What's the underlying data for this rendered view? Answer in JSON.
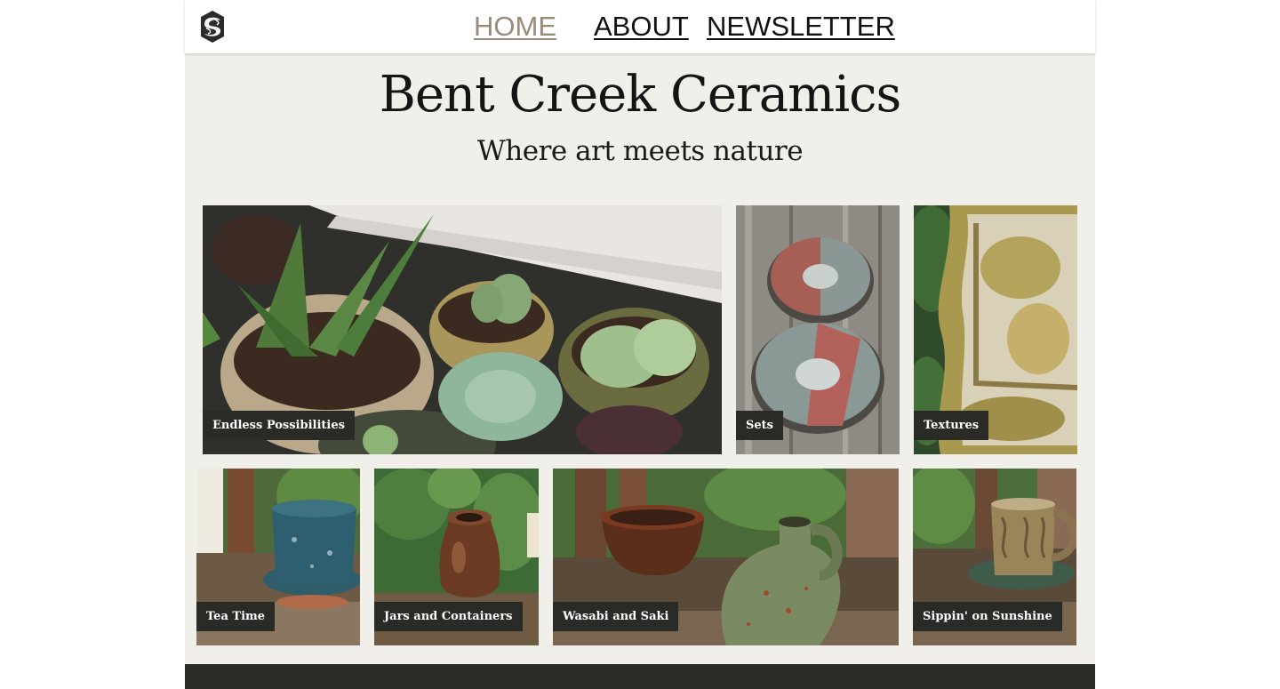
{
  "nav": {
    "logo_icon": "swirl-logo-icon",
    "links": [
      {
        "label": "HOME",
        "active": true
      },
      {
        "label": "ABOUT",
        "active": false
      },
      {
        "label": "NEWSLETTER",
        "active": false
      }
    ]
  },
  "hero": {
    "title": "Bent Creek Ceramics",
    "subtitle": "Where art meets nature"
  },
  "gallery": {
    "tiles": [
      {
        "caption": "Endless Possibilities"
      },
      {
        "caption": "Sets"
      },
      {
        "caption": "Textures"
      },
      {
        "caption": "Tea Time"
      },
      {
        "caption": "Jars and Containers"
      },
      {
        "caption": "Wasabi and Saki"
      },
      {
        "caption": "Sippin' on Sunshine"
      }
    ]
  },
  "colors": {
    "page_background": "#f0efea",
    "nav_active": "#9a8a79",
    "caption_background": "#2a2b27",
    "footer": "#2a2b27"
  }
}
